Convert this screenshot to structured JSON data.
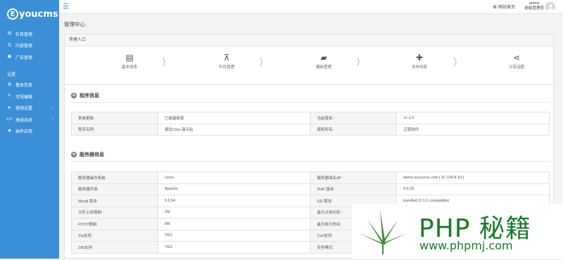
{
  "logo": {
    "mark": "E",
    "text": "youcms"
  },
  "sidebar": {
    "items": [
      {
        "label": "栏目管理",
        "icon": "sitemap-icon"
      },
      {
        "label": "内容管理",
        "icon": "list-icon"
      },
      {
        "label": "广告管理",
        "icon": "image-icon"
      }
    ],
    "section_label": "设置",
    "settings_items": [
      {
        "label": "基本信息",
        "icon": "gear-icon",
        "arrow": ""
      },
      {
        "label": "可视编辑",
        "icon": "pencil-icon",
        "arrow": "›"
      },
      {
        "label": "营销设置",
        "icon": "send-icon",
        "arrow": "›"
      },
      {
        "label": "高级选项",
        "icon": "code-icon",
        "arrow": "›"
      },
      {
        "label": "插件应用",
        "icon": "puzzle-icon",
        "arrow": ""
      }
    ]
  },
  "topbar": {
    "site_home": "网站首页",
    "username": "admin",
    "role": "超级管理员"
  },
  "page_title": "管理中心",
  "quick": {
    "heading": "快捷入口",
    "items": [
      {
        "label": "基本信息",
        "icon": "id-card-icon"
      },
      {
        "label": "栏目管理",
        "icon": "sitemap-icon"
      },
      {
        "label": "模板管理",
        "icon": "folder-open-icon"
      },
      {
        "label": "发布内容",
        "icon": "plus-icon"
      },
      {
        "label": "分享话题",
        "icon": "share-icon"
      }
    ]
  },
  "program_info": {
    "title": "程序信息",
    "rows": [
      [
        "系统更新:",
        "已是最新版",
        "当前版本:",
        "v1.1.5"
      ],
      [
        "程序名称:",
        "易优Cms-演示站",
        "版权所有:",
        "正版软件"
      ]
    ]
  },
  "server_info": {
    "title": "服务器信息",
    "rows": [
      [
        "服务器操作系统:",
        "Linux",
        "服务器域名/IP:",
        "demo.eyoucms.com [ 47.104.8.10 ]"
      ],
      [
        "服务器环境:",
        "Apache",
        "PHP 版本:",
        "5.6.30"
      ],
      [
        "Mysql 版本:",
        "5.5.54",
        "GD 版本:",
        "bundled (2.1.0 compatible)"
      ],
      [
        "文件上传限制:",
        "2M",
        "最大占用内存:",
        ""
      ],
      [
        "POST限制:",
        "8M",
        "最大执行时间:",
        ""
      ],
      [
        "Zip支持:",
        "YES",
        "Curl支持:",
        ""
      ],
      [
        "Zlib支持:",
        "YES",
        "安全模式:",
        ""
      ]
    ]
  },
  "watermark": {
    "text": "PHP 秘籍",
    "url": "www.phpmj.com"
  },
  "colors": {
    "sidebar": "#3a8fd6",
    "watermark": "#1a7a2a"
  }
}
